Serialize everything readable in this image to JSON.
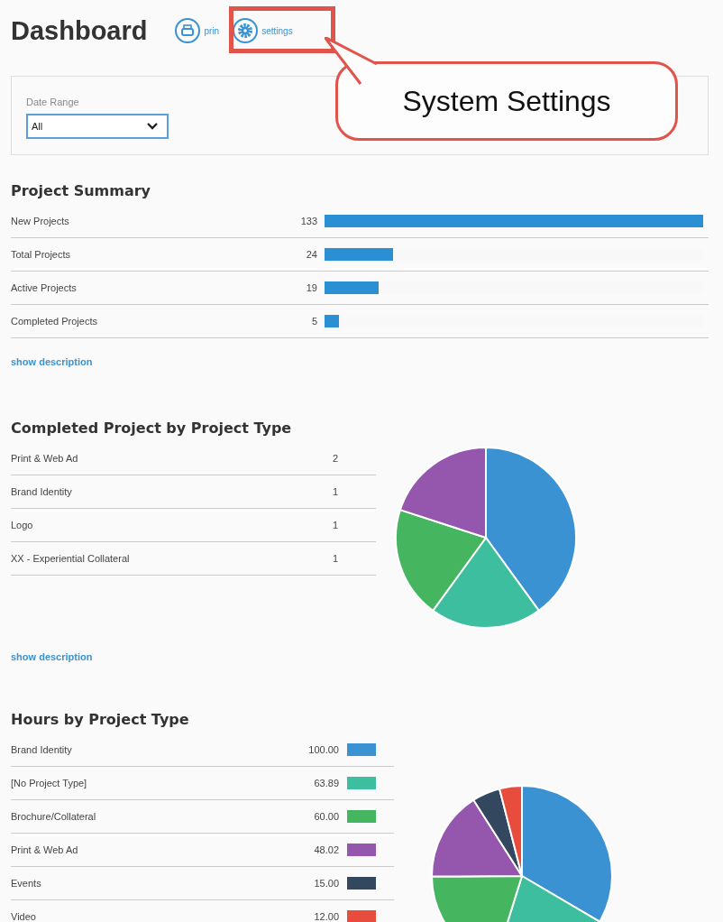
{
  "header": {
    "title": "Dashboard",
    "print_link": "prin",
    "settings_link": "settings"
  },
  "callout": {
    "text": "System Settings"
  },
  "filter": {
    "label": "Date Range",
    "value": "All"
  },
  "project_summary": {
    "title": "Project Summary",
    "rows": [
      {
        "label": "New Projects",
        "value": "133",
        "level": 1
      },
      {
        "label": "Total Projects",
        "value": "24",
        "level": 0.18
      },
      {
        "label": "Active Projects",
        "value": "19",
        "level": 0.143
      },
      {
        "label": "Completed Projects",
        "value": "5",
        "level": 0.038
      }
    ],
    "link": "show description"
  },
  "completed_by_type": {
    "title": "Completed Project by Project Type",
    "rows": [
      {
        "label": "Print & Web Ad",
        "value": "2"
      },
      {
        "label": "Brand Identity",
        "value": "1"
      },
      {
        "label": "Logo",
        "value": "1"
      },
      {
        "label": "XX - Experiential Collateral",
        "value": "1"
      }
    ],
    "link": "show description"
  },
  "hours_by_type": {
    "title": "Hours by Project Type",
    "rows": [
      {
        "label": "Brand Identity",
        "value": "100.00",
        "color": "#3b92d2"
      },
      {
        "label": "[No Project Type]",
        "value": "63.89",
        "color": "#3dbf9f"
      },
      {
        "label": "Brochure/Collateral",
        "value": "60.00",
        "color": "#45b560"
      },
      {
        "label": "Print & Web Ad",
        "value": "48.02",
        "color": "#9457ad"
      },
      {
        "label": "Events",
        "value": "15.00",
        "color": "#33475e"
      },
      {
        "label": "Video",
        "value": "12.00",
        "color": "#e74c3c"
      }
    ]
  }
}
